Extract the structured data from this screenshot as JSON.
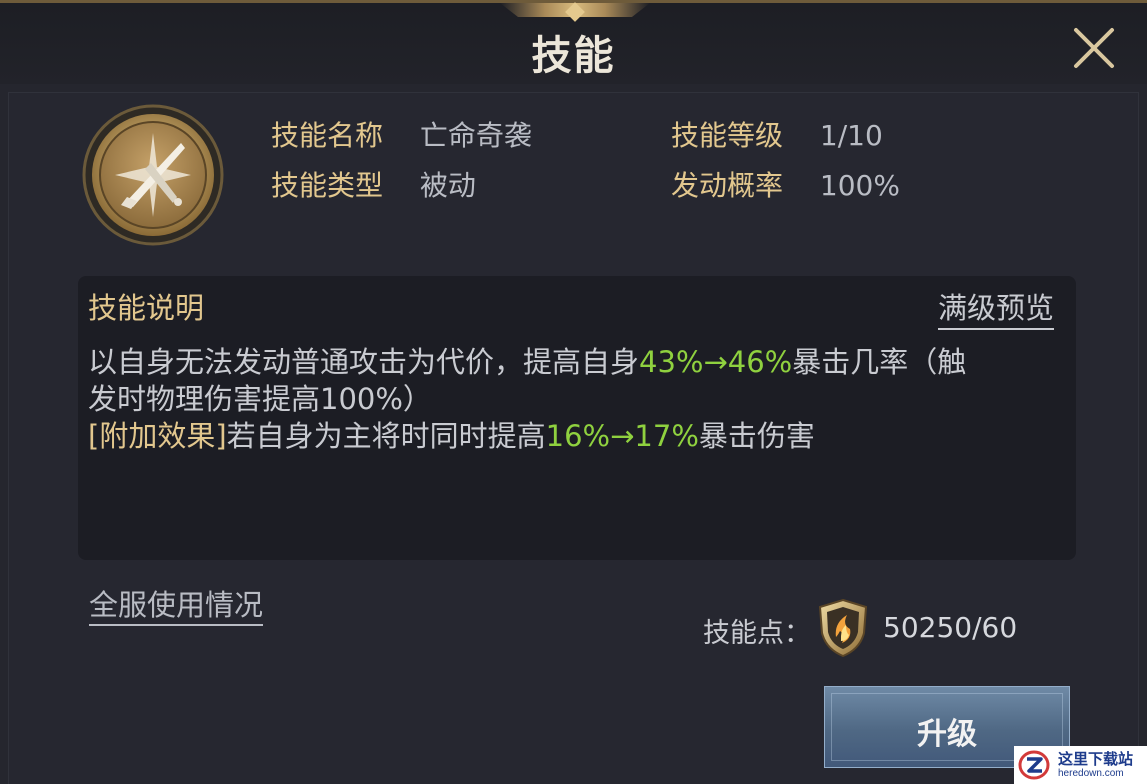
{
  "header": {
    "title": "技能"
  },
  "skill": {
    "name_label": "技能名称",
    "name_value": "亡命奇袭",
    "type_label": "技能类型",
    "type_value": "被动",
    "level_label": "技能等级",
    "level_value": "1/10",
    "rate_label": "发动概率",
    "rate_value": "100%"
  },
  "description": {
    "title": "技能说明",
    "preview_link": "满级预览",
    "line1_a": "以自身无法发动普通攻击为代价，提高自身",
    "line1_b": "43%→46%",
    "line1_c": "暴击几率（触",
    "line2": "发时物理伤害提高100%）",
    "line3_a": "[附加效果]",
    "line3_b": "若自身为主将时同时提高",
    "line3_c": "16%→17%",
    "line3_d": "暴击伤害"
  },
  "footer": {
    "usage_link": "全服使用情况",
    "points_label": "技能点：",
    "points_value": "50250/60",
    "upgrade_button": "升级"
  },
  "watermark": {
    "text": "这里下载站",
    "sub": "heredown.com"
  },
  "colors": {
    "gold": "#e2c78e",
    "green": "#8fd13f",
    "background": "#25262e",
    "button": "#4f6884"
  }
}
